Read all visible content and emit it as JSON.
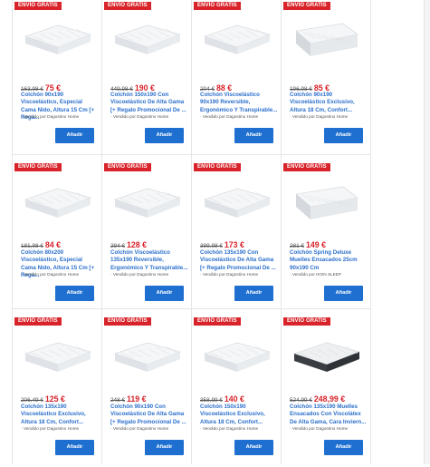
{
  "badge_label": "ENVÍO GRATIS",
  "add_label": "Añadir",
  "products": [
    {
      "old_price": "163,98 €",
      "price": "75 €",
      "title": "Colchón 90x190 Viscoelástico, Especial Cama Nido, Altura 15 Cm [+ Rega...",
      "seller": "· Vendido por Dagostino Home"
    },
    {
      "old_price": "449,98 €",
      "price": "190 €",
      "title": "Colchón 150x190 Con Viscoelástico De Alta Gama [+ Regalo Promocional De ...",
      "seller": "· Vendido por Dagostino Home"
    },
    {
      "old_price": "204 €",
      "price": "88 €",
      "title": "Colchón Viscoelástico 90x190 Reversible, Ergonómico Y Transpirable...",
      "seller": "· Vendido por Dagostino Home"
    },
    {
      "old_price": "196,98 €",
      "price": "85 €",
      "title": "Colchón 90x190 Viscoelástico Exclusivo, Altura 18 Cm, Confort...",
      "seller": "· Vendido por Dagostino Home"
    },
    {
      "old_price": "181,98 €",
      "price": "84 €",
      "title": "Colchón 80x200 Viscoelástico, Especial Cama Nido, Altura 15 Cm [+ Rega...",
      "seller": "· Vendido por Dagostino Home"
    },
    {
      "old_price": "294 €",
      "price": "128 €",
      "title": "Colchón Viscoelástico 135x190 Reversible, Ergonómico Y Transpirable...",
      "seller": "· Vendido por Dagostino Home"
    },
    {
      "old_price": "399,98 €",
      "price": "173 €",
      "title": "Colchón 135x190 Con Viscoelástico De Alta Gama [+ Regalo Promocional De ...",
      "seller": "· Vendido por Dagostino Home"
    },
    {
      "old_price": "281 €",
      "price": "149 €",
      "title": "Colchón Spring Deluxe Muelles Ensacados 25cm 90x190 Cm",
      "seller": "· Vendido por IKON SLEEP"
    },
    {
      "old_price": "206,49 €",
      "price": "125 €",
      "title": "Colchón 135x190 Viscoelástico Exclusivo, Altura 18 Cm, Confort...",
      "seller": "· Vendido por Dagostino Home"
    },
    {
      "old_price": "248 €",
      "price": "119 €",
      "title": "Colchón 90x190 Con Viscoelástico De Alta Gama [+ Regalo Promocional De ...",
      "seller": "· Vendido por Dagostino Home"
    },
    {
      "old_price": "358,99 €",
      "price": "140 €",
      "title": "Colchón 150x190 Viscoelástico Exclusivo, Altura 18 Cm, Confort...",
      "seller": "· Vendido por Dagostino Home"
    },
    {
      "old_price": "524,99 €",
      "price": "248,99 €",
      "title": "Colchón 135x190 Muelles Ensacados Con Viscolátex De Alta Gama, Cara Inviern...",
      "seller": "· Vendido por Dagostino Home"
    }
  ],
  "colors": {
    "badge": "#d8232a",
    "price": "#d8232a",
    "title": "#2b6fcb",
    "button": "#1f6fd1"
  }
}
